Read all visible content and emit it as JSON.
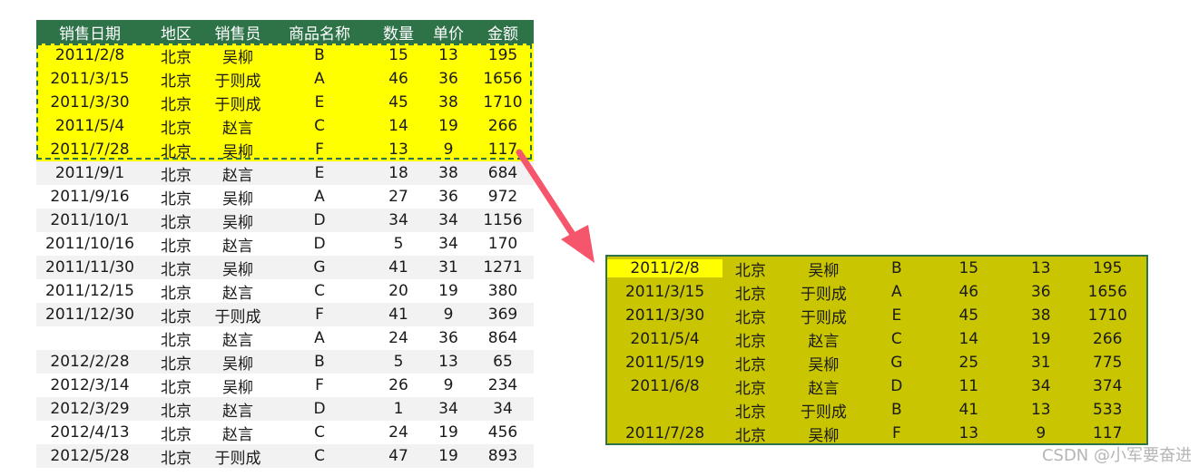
{
  "sheet": {
    "headers": [
      "销售日期",
      "地区",
      "销售员",
      "商品名称",
      "数量",
      "单价",
      "金额"
    ],
    "rows": [
      [
        "2011/2/8",
        "北京",
        "吴柳",
        "B",
        "15",
        "13",
        "195"
      ],
      [
        "2011/3/15",
        "北京",
        "于则成",
        "A",
        "46",
        "36",
        "1656"
      ],
      [
        "2011/3/30",
        "北京",
        "于则成",
        "E",
        "45",
        "38",
        "1710"
      ],
      [
        "2011/5/4",
        "北京",
        "赵言",
        "C",
        "14",
        "19",
        "266"
      ],
      [
        "2011/7/28",
        "北京",
        "吴柳",
        "F",
        "13",
        "9",
        "117"
      ],
      [
        "2011/9/1",
        "北京",
        "赵言",
        "E",
        "18",
        "38",
        "684"
      ],
      [
        "2011/9/16",
        "北京",
        "吴柳",
        "A",
        "27",
        "36",
        "972"
      ],
      [
        "2011/10/1",
        "北京",
        "吴柳",
        "D",
        "34",
        "34",
        "1156"
      ],
      [
        "2011/10/16",
        "北京",
        "赵言",
        "D",
        "5",
        "34",
        "170"
      ],
      [
        "2011/11/30",
        "北京",
        "吴柳",
        "G",
        "41",
        "31",
        "1271"
      ],
      [
        "2011/12/15",
        "北京",
        "赵言",
        "C",
        "20",
        "19",
        "380"
      ],
      [
        "2011/12/30",
        "北京",
        "于则成",
        "F",
        "41",
        "9",
        "369"
      ],
      [
        "",
        "北京",
        "赵言",
        "A",
        "24",
        "36",
        "864"
      ],
      [
        "2012/2/28",
        "北京",
        "吴柳",
        "B",
        "5",
        "13",
        "65"
      ],
      [
        "2012/3/14",
        "北京",
        "吴柳",
        "F",
        "26",
        "9",
        "234"
      ],
      [
        "2012/3/29",
        "北京",
        "赵言",
        "D",
        "1",
        "34",
        "34"
      ],
      [
        "2012/4/13",
        "北京",
        "赵言",
        "C",
        "24",
        "19",
        "456"
      ],
      [
        "2012/5/28",
        "北京",
        "于则成",
        "C",
        "47",
        "19",
        "893"
      ]
    ]
  },
  "result": {
    "rows": [
      [
        "2011/2/8",
        "北京",
        "吴柳",
        "B",
        "15",
        "13",
        "195"
      ],
      [
        "2011/3/15",
        "北京",
        "于则成",
        "A",
        "46",
        "36",
        "1656"
      ],
      [
        "2011/3/30",
        "北京",
        "于则成",
        "E",
        "45",
        "38",
        "1710"
      ],
      [
        "2011/5/4",
        "北京",
        "赵言",
        "C",
        "14",
        "19",
        "266"
      ],
      [
        "2011/5/19",
        "北京",
        "吴柳",
        "G",
        "25",
        "31",
        "775"
      ],
      [
        "2011/6/8",
        "北京",
        "赵言",
        "D",
        "11",
        "34",
        "374"
      ],
      [
        "",
        "北京",
        "于则成",
        "B",
        "41",
        "13",
        "533"
      ],
      [
        "2011/7/28",
        "北京",
        "吴柳",
        "F",
        "13",
        "9",
        "117"
      ]
    ]
  },
  "watermark": "CSDN @小军要奋进",
  "colors": {
    "header_bg": "#2e7248",
    "highlight": "#ffff00",
    "result_bg": "#c9c500",
    "arrow": "#f5566b"
  }
}
